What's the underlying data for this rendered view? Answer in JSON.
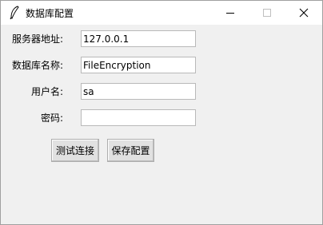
{
  "window": {
    "title": "数据库配置",
    "app_icon": "feather-icon",
    "controls": {
      "minimize_icon": "minimize-icon",
      "maximize_icon": "maximize-icon",
      "close_icon": "close-icon"
    }
  },
  "form": {
    "server": {
      "label": "服务器地址:",
      "value": "127.0.0.1"
    },
    "database": {
      "label": "数据库名称:",
      "value": "FileEncryption"
    },
    "username": {
      "label": "用户名:",
      "value": "sa"
    },
    "password": {
      "label": "密码:",
      "value": ""
    }
  },
  "buttons": {
    "test_label": "测试连接",
    "save_label": "保存配置"
  },
  "colors": {
    "window_bg": "#f0f0f0",
    "titlebar_bg": "#ffffff",
    "button_bg": "#e1e1e1"
  }
}
